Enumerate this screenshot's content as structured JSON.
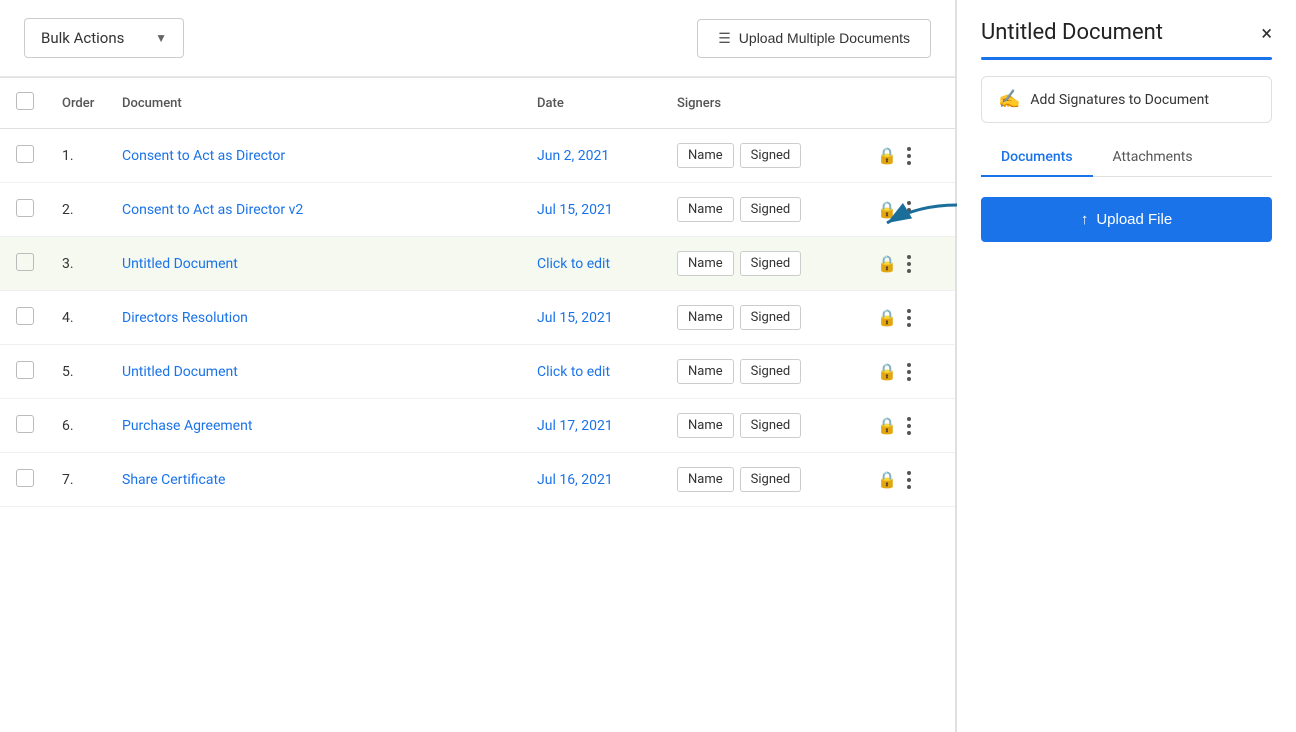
{
  "toolbar": {
    "bulk_actions_label": "Bulk Actions",
    "upload_multiple_label": "Upload Multiple Documents"
  },
  "table": {
    "headers": {
      "order": "Order",
      "document": "Document",
      "date": "Date",
      "signers": "Signers"
    },
    "rows": [
      {
        "id": 1,
        "order": "1.",
        "document": "Consent to Act as Director",
        "date": "Jun 2, 2021",
        "date_type": "date",
        "signer_name": "Name",
        "signer_status": "Signed",
        "highlighted": false
      },
      {
        "id": 2,
        "order": "2.",
        "document": "Consent to Act as Director v2",
        "date": "Jul 15, 2021",
        "date_type": "date",
        "signer_name": "Name",
        "signer_status": "Signed",
        "highlighted": false
      },
      {
        "id": 3,
        "order": "3.",
        "document": "Untitled Document",
        "date": "Click to edit",
        "date_type": "editable",
        "signer_name": "Name",
        "signer_status": "Signed",
        "highlighted": true
      },
      {
        "id": 4,
        "order": "4.",
        "document": "Directors Resolution",
        "date": "Jul 15, 2021",
        "date_type": "date",
        "signer_name": "Name",
        "signer_status": "Signed",
        "highlighted": false
      },
      {
        "id": 5,
        "order": "5.",
        "document": "Untitled Document",
        "date": "Click to edit",
        "date_type": "editable",
        "signer_name": "Name",
        "signer_status": "Signed",
        "highlighted": false
      },
      {
        "id": 6,
        "order": "6.",
        "document": "Purchase Agreement",
        "date": "Jul 17, 2021",
        "date_type": "date",
        "signer_name": "Name",
        "signer_status": "Signed",
        "highlighted": false
      },
      {
        "id": 7,
        "order": "7.",
        "document": "Share Certificate",
        "date": "Jul 16, 2021",
        "date_type": "date",
        "signer_name": "Name",
        "signer_status": "Signed",
        "highlighted": false
      }
    ]
  },
  "right_panel": {
    "title": "Untitled Document",
    "add_signatures_label": "Add Signatures to Document",
    "tabs": [
      "Documents",
      "Attachments"
    ],
    "active_tab": "Documents",
    "upload_file_label": "Upload File",
    "close_label": "×"
  }
}
